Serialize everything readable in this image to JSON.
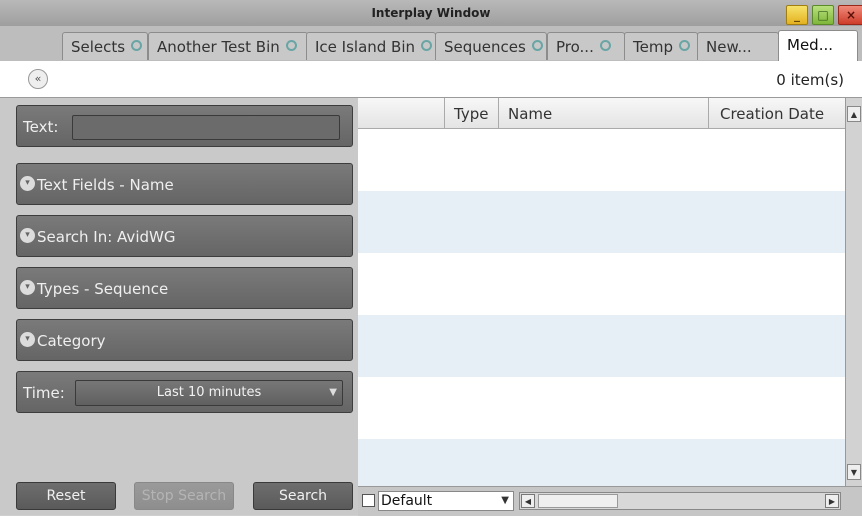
{
  "window": {
    "title": "Interplay Window"
  },
  "tabs": [
    {
      "label": "Selects"
    },
    {
      "label": "Another Test Bin"
    },
    {
      "label": "Ice Island Bin"
    },
    {
      "label": "Sequences"
    },
    {
      "label": "Pro..."
    },
    {
      "label": "Temp"
    },
    {
      "label": "New..."
    },
    {
      "label": "Med..."
    }
  ],
  "toolbar": {
    "item_count": "0 item(s)"
  },
  "search": {
    "text_label": "Text:",
    "text_value": "",
    "text_fields": "Text Fields - Name",
    "search_in": "Search In: AvidWG",
    "types": "Types - Sequence",
    "category": "Category",
    "time_label": "Time:",
    "time_value": "Last 10 minutes",
    "reset_label": "Reset",
    "stop_label": "Stop Search",
    "search_label": "Search"
  },
  "results": {
    "columns": [
      "Type",
      "Name",
      "Creation Date"
    ]
  },
  "footer": {
    "view_value": "Default"
  }
}
